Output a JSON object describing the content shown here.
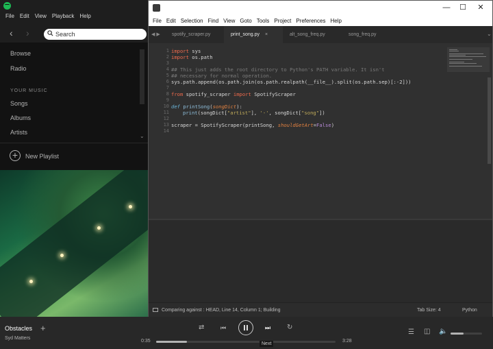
{
  "spotify": {
    "menu": [
      "File",
      "Edit",
      "View",
      "Playback",
      "Help"
    ],
    "search_placeholder": "Search",
    "nav": {
      "browse": "Browse",
      "radio": "Radio"
    },
    "your_music_heading": "YOUR MUSIC",
    "music": {
      "songs": "Songs",
      "albums": "Albums",
      "artists": "Artists"
    },
    "new_playlist": "New Playlist"
  },
  "sublime": {
    "menu": [
      "File",
      "Edit",
      "Selection",
      "Find",
      "View",
      "Goto",
      "Tools",
      "Project",
      "Preferences",
      "Help"
    ],
    "tabs": [
      {
        "label": "spotify_scraper.py",
        "active": false
      },
      {
        "label": "print_song.py",
        "active": true
      },
      {
        "label": "alt_song_freq.py",
        "active": false
      },
      {
        "label": "song_freq.py",
        "active": false
      }
    ],
    "line_numbers": [
      "1",
      "2",
      "3",
      "4",
      "5",
      "6",
      "7",
      "8",
      "9",
      "10",
      "11",
      "12",
      "13",
      "14"
    ],
    "code_lines": [
      [
        [
          "kw",
          "import"
        ],
        [
          "",
          "sys"
        ]
      ],
      [
        [
          "kw",
          "import"
        ],
        [
          "",
          "os.path"
        ]
      ],
      [],
      [
        [
          "cm",
          "## This just adds the root directory to Python's PATH variable. It isn't"
        ]
      ],
      [
        [
          "cm",
          "## necessary for normal operation."
        ]
      ],
      [
        [
          "",
          "sys.path.append(os.path.join(os.path.realpath(__file__).split(os.path.sep)[:-2]))"
        ]
      ],
      [],
      [
        [
          "kw",
          "from"
        ],
        [
          "",
          "spotify_scraper "
        ],
        [
          "kw",
          "import"
        ],
        [
          "",
          "SpotifyScraper"
        ]
      ],
      [],
      [
        [
          "kwi",
          "def"
        ],
        [
          "fn",
          "printSong"
        ],
        [
          "",
          "("
        ],
        [
          "it",
          "songDict"
        ],
        [
          "",
          "):"
        ]
      ],
      [
        [
          "",
          ""
        ],
        [
          "fn",
          "print"
        ],
        [
          "",
          "(songDict["
        ],
        [
          "st",
          "\"artist\""
        ],
        [
          "",
          "], "
        ],
        [
          "st",
          "'-'"
        ],
        [
          "",
          ", songDict["
        ],
        [
          "st",
          "\"song\""
        ],
        [
          "",
          "])"
        ]
      ],
      [],
      [
        [
          "",
          "scraper = SpotifyScraper(printSong, "
        ],
        [
          "it",
          "shouldGetArt"
        ],
        [
          "",
          "="
        ],
        [
          "num",
          "False"
        ],
        [
          "",
          ")"
        ]
      ],
      []
    ],
    "status": {
      "message": "Comparing against : HEAD, Line 14, Column 1; Building",
      "tab_size": "Tab Size: 4",
      "syntax": "Python"
    }
  },
  "player": {
    "track": "Obstacles",
    "artist": "Syd Matters",
    "elapsed": "0:35",
    "duration": "3:28",
    "progress": 0.17,
    "volume": 0.42,
    "tooltip": "Next"
  }
}
